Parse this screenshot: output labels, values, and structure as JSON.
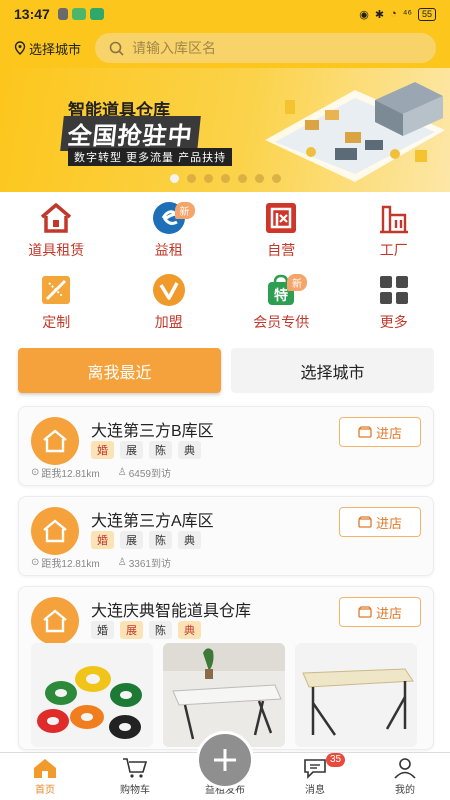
{
  "status_bar": {
    "time": "13:47",
    "signal": "⁴⁶",
    "battery": "55"
  },
  "header": {
    "city_label": "选择城市",
    "search_placeholder": "请输入库区名"
  },
  "banner": {
    "title": "智能道具仓库",
    "headline": "全国抢驻中",
    "subtitle": "数字转型 更多流量 产品扶持",
    "dots": 7,
    "active_dot": 0
  },
  "categories": [
    {
      "label": "道具租赁",
      "icon": "house-icon",
      "badge": ""
    },
    {
      "label": "益租",
      "icon": "e-leaf-icon",
      "badge": "新"
    },
    {
      "label": "自营",
      "icon": "shop-icon",
      "badge": ""
    },
    {
      "label": "工厂",
      "icon": "factory-icon",
      "badge": ""
    },
    {
      "label": "定制",
      "icon": "ruler-icon",
      "badge": ""
    },
    {
      "label": "加盟",
      "icon": "check-v-icon",
      "badge": ""
    },
    {
      "label": "会员专供",
      "icon": "special-bag-icon",
      "badge": "新"
    },
    {
      "label": "更多",
      "icon": "grid-icon",
      "badge": ""
    }
  ],
  "tabs": {
    "nearest": "离我最近",
    "select_city": "选择城市"
  },
  "stores": [
    {
      "name": "大连第三方B库区",
      "tags": [
        "婚",
        "展",
        "陈",
        "典"
      ],
      "highlight_tags": [
        0
      ],
      "distance": "距我12.81km",
      "visits": "6459到访",
      "enter_label": "进店"
    },
    {
      "name": "大连第三方A库区",
      "tags": [
        "婚",
        "展",
        "陈",
        "典"
      ],
      "highlight_tags": [
        0
      ],
      "distance": "距我12.81km",
      "visits": "3361到访",
      "enter_label": "进店"
    },
    {
      "name": "大连庆典智能道具仓库",
      "tags": [
        "婚",
        "展",
        "陈",
        "典"
      ],
      "highlight_tags": [
        1,
        3
      ],
      "enter_label": "进店"
    }
  ],
  "bottom_nav": {
    "home": "首页",
    "cart": "购物车",
    "publish": "益租发布",
    "messages": "消息",
    "messages_badge": "35",
    "mine": "我的"
  },
  "colors": {
    "brand_yellow": "#fcc61c",
    "accent_orange": "#f6a23c",
    "category_red": "#c0392b"
  }
}
